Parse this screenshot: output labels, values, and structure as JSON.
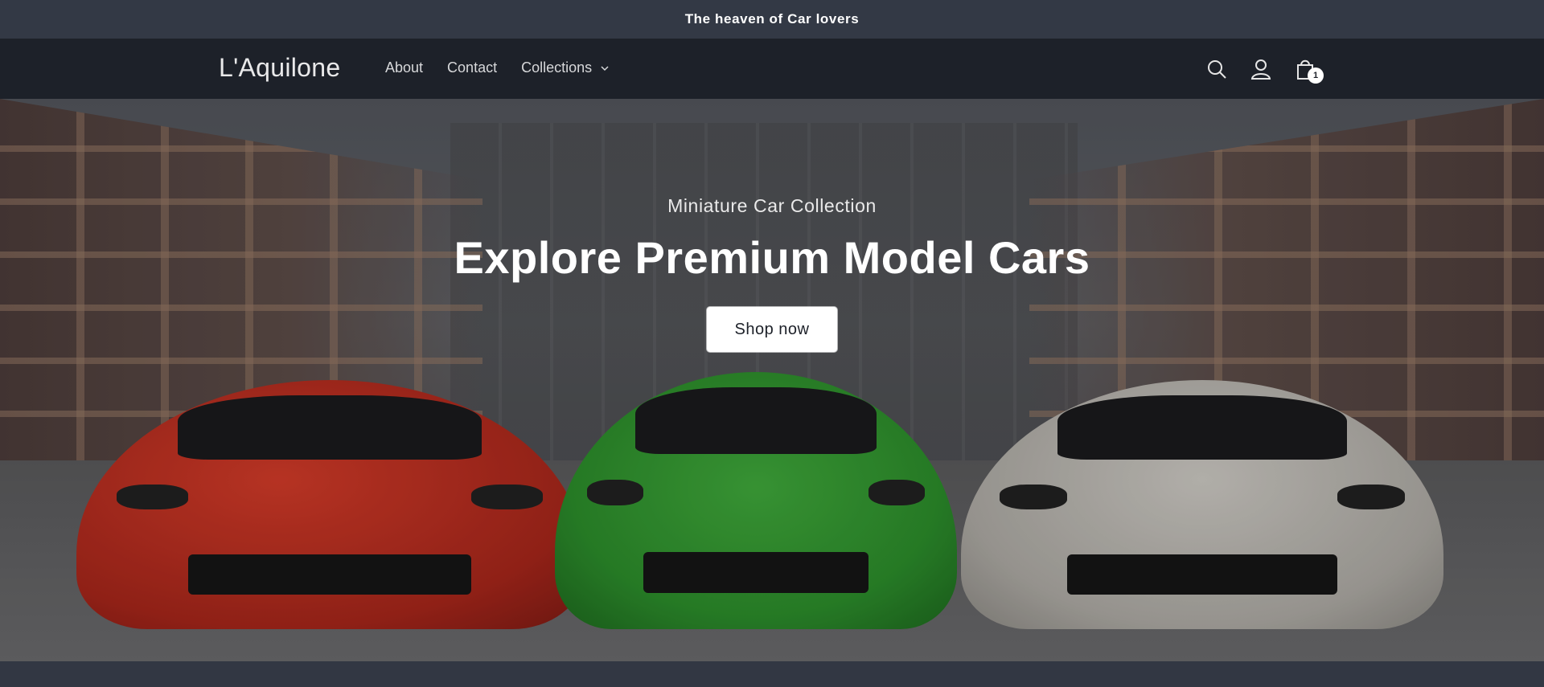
{
  "announcement": {
    "text": "The heaven of Car lovers"
  },
  "header": {
    "logo": "L'Aquilone",
    "nav": [
      {
        "label": "About"
      },
      {
        "label": "Contact"
      },
      {
        "label": "Collections"
      }
    ],
    "icons": [
      "search-icon",
      "account-icon",
      "cart-icon"
    ],
    "cart_count": "1"
  },
  "hero": {
    "subtitle": "Miniature Car Collection",
    "title": "Explore Premium Model Cars",
    "button_label": "Shop now"
  },
  "colors": {
    "announcement_bg": "#333945",
    "header_bg": "#1d2129",
    "button_bg": "#ffffff"
  }
}
